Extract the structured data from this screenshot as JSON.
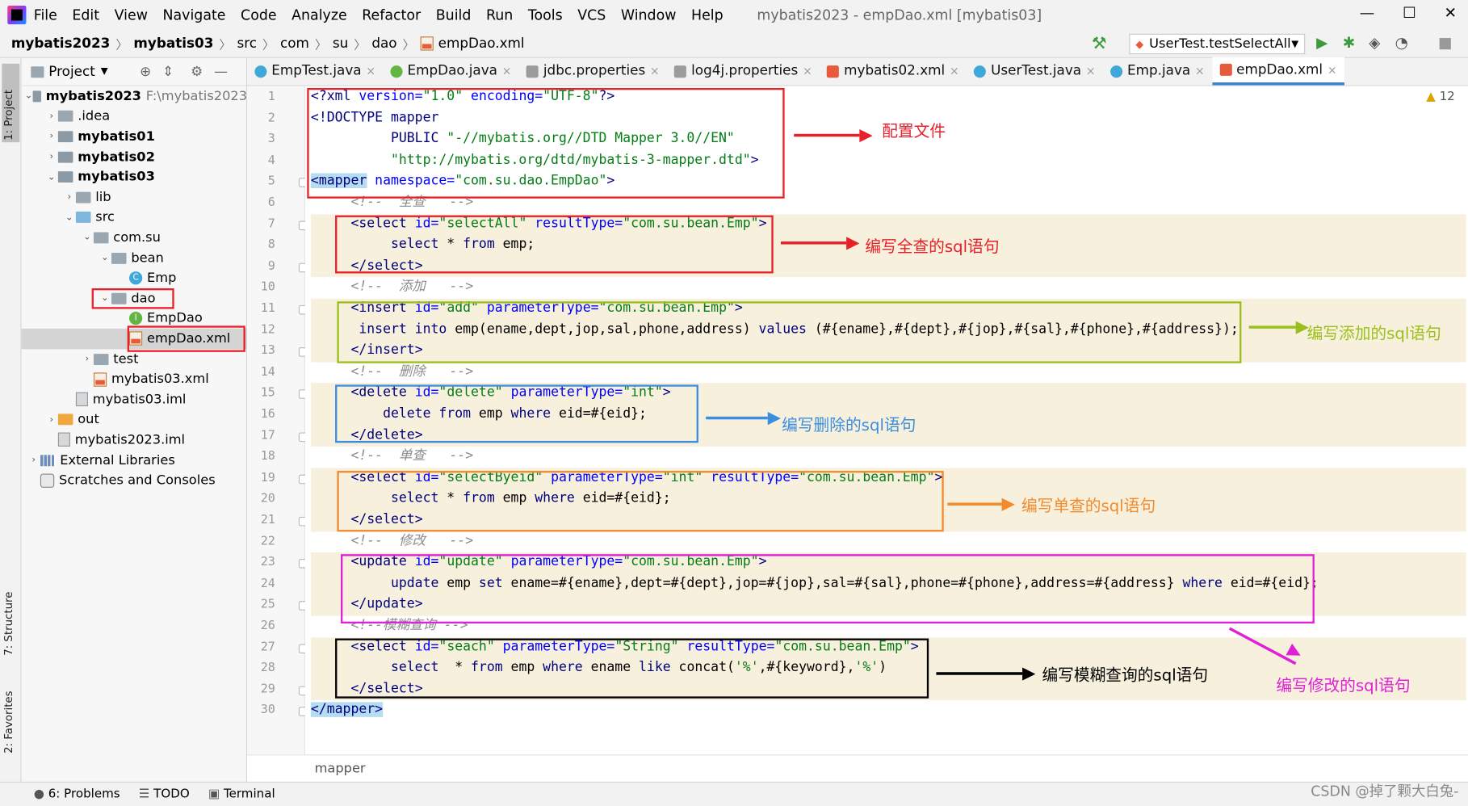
{
  "app": {
    "title": "mybatis2023 - empDao.xml [mybatis03]"
  },
  "menu": [
    "File",
    "Edit",
    "View",
    "Navigate",
    "Code",
    "Analyze",
    "Refactor",
    "Build",
    "Run",
    "Tools",
    "VCS",
    "Window",
    "Help"
  ],
  "breadcrumb": {
    "project": "mybatis2023",
    "module": "mybatis03",
    "p1": "src",
    "p2": "com",
    "p3": "su",
    "p4": "dao",
    "file": "empDao.xml"
  },
  "run_config": "UserTest.testSelectAll",
  "project_panel": {
    "title": "Project",
    "tree": [
      {
        "label": "mybatis2023",
        "extra": "F:\\mybatis2023"
      },
      {
        "label": ".idea"
      },
      {
        "label": "mybatis01"
      },
      {
        "label": "mybatis02"
      },
      {
        "label": "mybatis03"
      },
      {
        "label": "lib"
      },
      {
        "label": "src"
      },
      {
        "label": "com.su"
      },
      {
        "label": "bean"
      },
      {
        "label": "Emp"
      },
      {
        "label": "dao"
      },
      {
        "label": "EmpDao"
      },
      {
        "label": "empDao.xml"
      },
      {
        "label": "test"
      },
      {
        "label": "mybatis03.xml"
      },
      {
        "label": "mybatis03.iml"
      },
      {
        "label": "out"
      },
      {
        "label": "mybatis2023.iml"
      },
      {
        "label": "External Libraries"
      },
      {
        "label": "Scratches and Consoles"
      }
    ]
  },
  "tabs": [
    "EmpTest.java",
    "EmpDao.java",
    "jdbc.properties",
    "log4j.properties",
    "mybatis02.xml",
    "UserTest.java",
    "Emp.java",
    "empDao.xml"
  ],
  "editor": {
    "warnings": "12",
    "lines": [
      "1",
      "2",
      "3",
      "4",
      "5",
      "6",
      "7",
      "8",
      "9",
      "10",
      "11",
      "12",
      "13",
      "14",
      "15",
      "16",
      "17",
      "18",
      "19",
      "20",
      "21",
      "22",
      "23",
      "24",
      "25",
      "26",
      "27",
      "28",
      "29",
      "30"
    ]
  },
  "annotations": {
    "config": "配置文件",
    "select_all": "编写全查的sql语句",
    "insert": "编写添加的sql语句",
    "delete": "编写删除的sql语句",
    "select_one": "编写单查的sql语句",
    "update": "编写修改的sql语句",
    "fuzzy": "编写模糊查询的sql语句"
  },
  "colors": {
    "red": "#e8202a",
    "green": "#9bbf1a",
    "blue": "#3a8ee0",
    "orange": "#f28a2e",
    "magenta": "#e020d8",
    "black": "#000000"
  },
  "editor_breadcrumb": "mapper",
  "statusbar": {
    "problems": "6: Problems",
    "todo": "TODO",
    "terminal": "Terminal"
  },
  "left_stripe": {
    "project": "1: Project",
    "structure": "7: Structure",
    "favorites": "2: Favorites"
  },
  "watermark": "CSDN @掉了颗大白兔-"
}
